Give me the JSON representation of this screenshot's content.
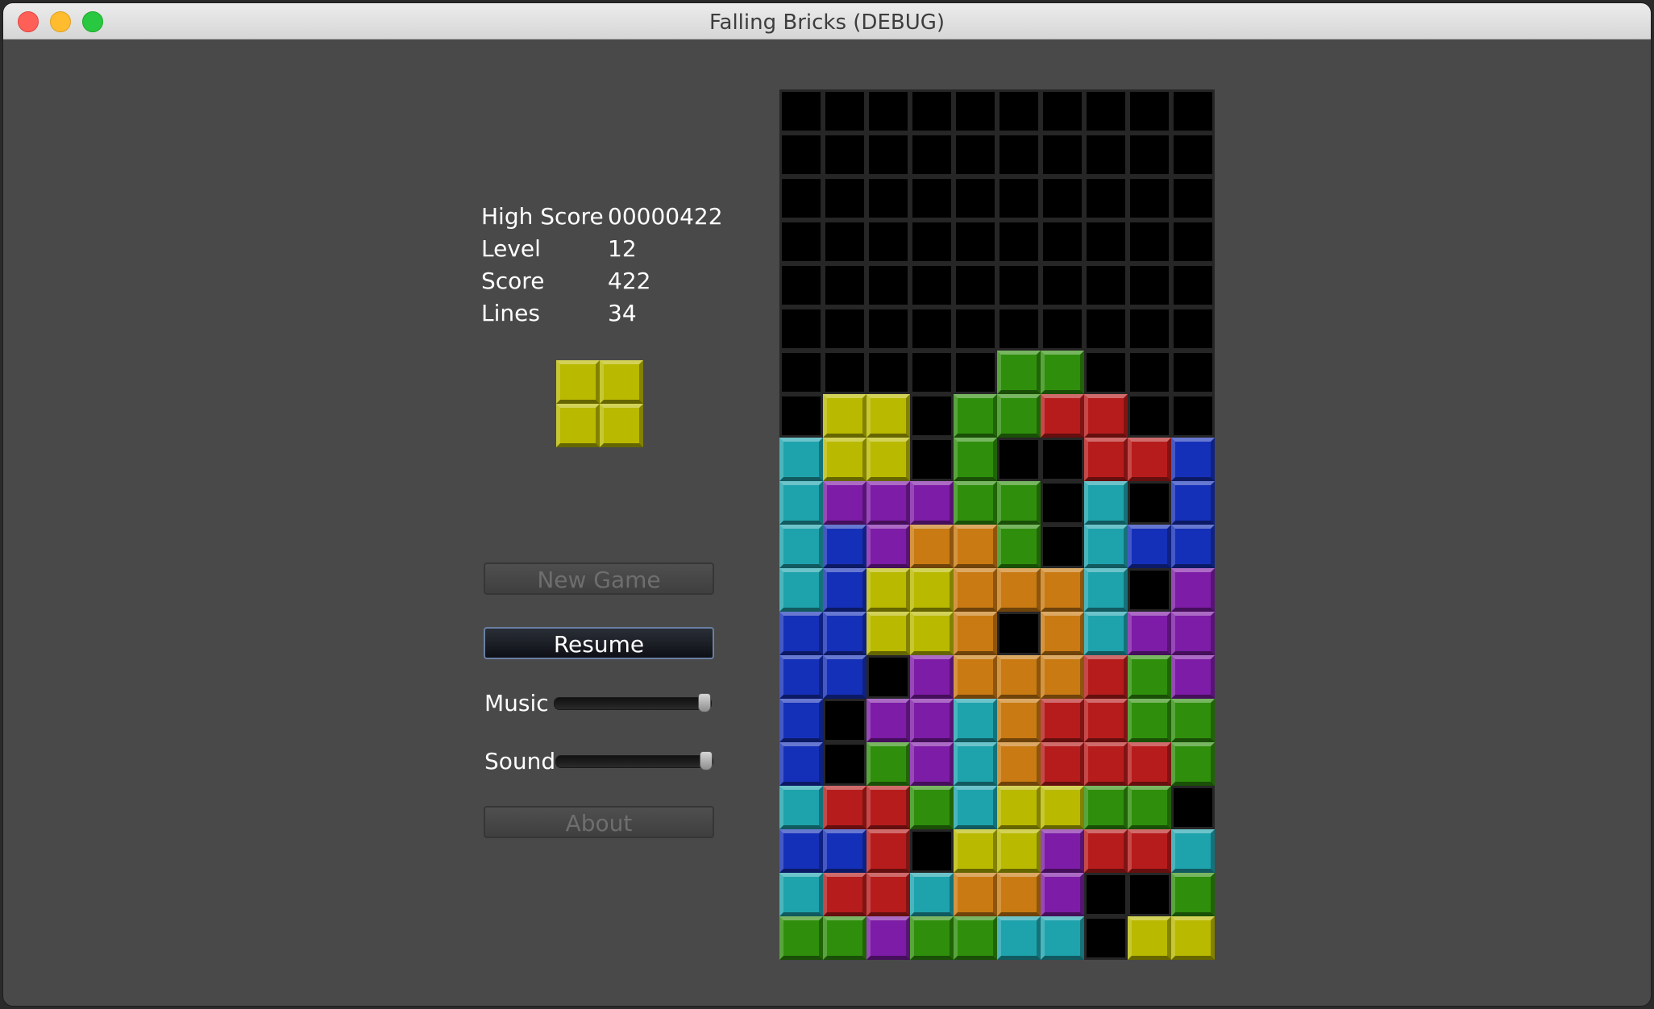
{
  "window": {
    "title": "Falling Bricks (DEBUG)"
  },
  "stats": [
    {
      "label": "High Score",
      "value": "00000422"
    },
    {
      "label": "Level",
      "value": "12"
    },
    {
      "label": "Score",
      "value": "422"
    },
    {
      "label": "Lines",
      "value": "34"
    }
  ],
  "buttons": {
    "new_game": "New Game",
    "resume": "Resume",
    "about": "About"
  },
  "sliders": {
    "music": {
      "label": "Music",
      "value": 1.0
    },
    "sound": {
      "label": "Sound",
      "value": 1.0
    }
  },
  "colors": {
    "Y": "#b9b900",
    "G": "#2f8f0c",
    "R": "#b71c1c",
    "C": "#1ea3ad",
    "B": "#1530b8",
    "P": "#7d1ca6",
    "O": "#c97a12"
  },
  "next_piece": [
    "YY",
    "YY"
  ],
  "board": [
    "..........",
    "..........",
    "..........",
    "..........",
    "..........",
    "..........",
    ".....GG...",
    ".YY.GGRR..",
    "CYY.G..RRB",
    "CPPPGG.C.B",
    "CBPOOG.CBB",
    "CBYYOOOC.P",
    "BBYYO.OCPP",
    "BB.POOORGP",
    "B.PPCORRGG",
    "B.GPCORRRG",
    "CRRGCYYGG.",
    "BBR.YYPRRC",
    "CRRCOOP..G",
    "GGPGGCC.YY"
  ]
}
